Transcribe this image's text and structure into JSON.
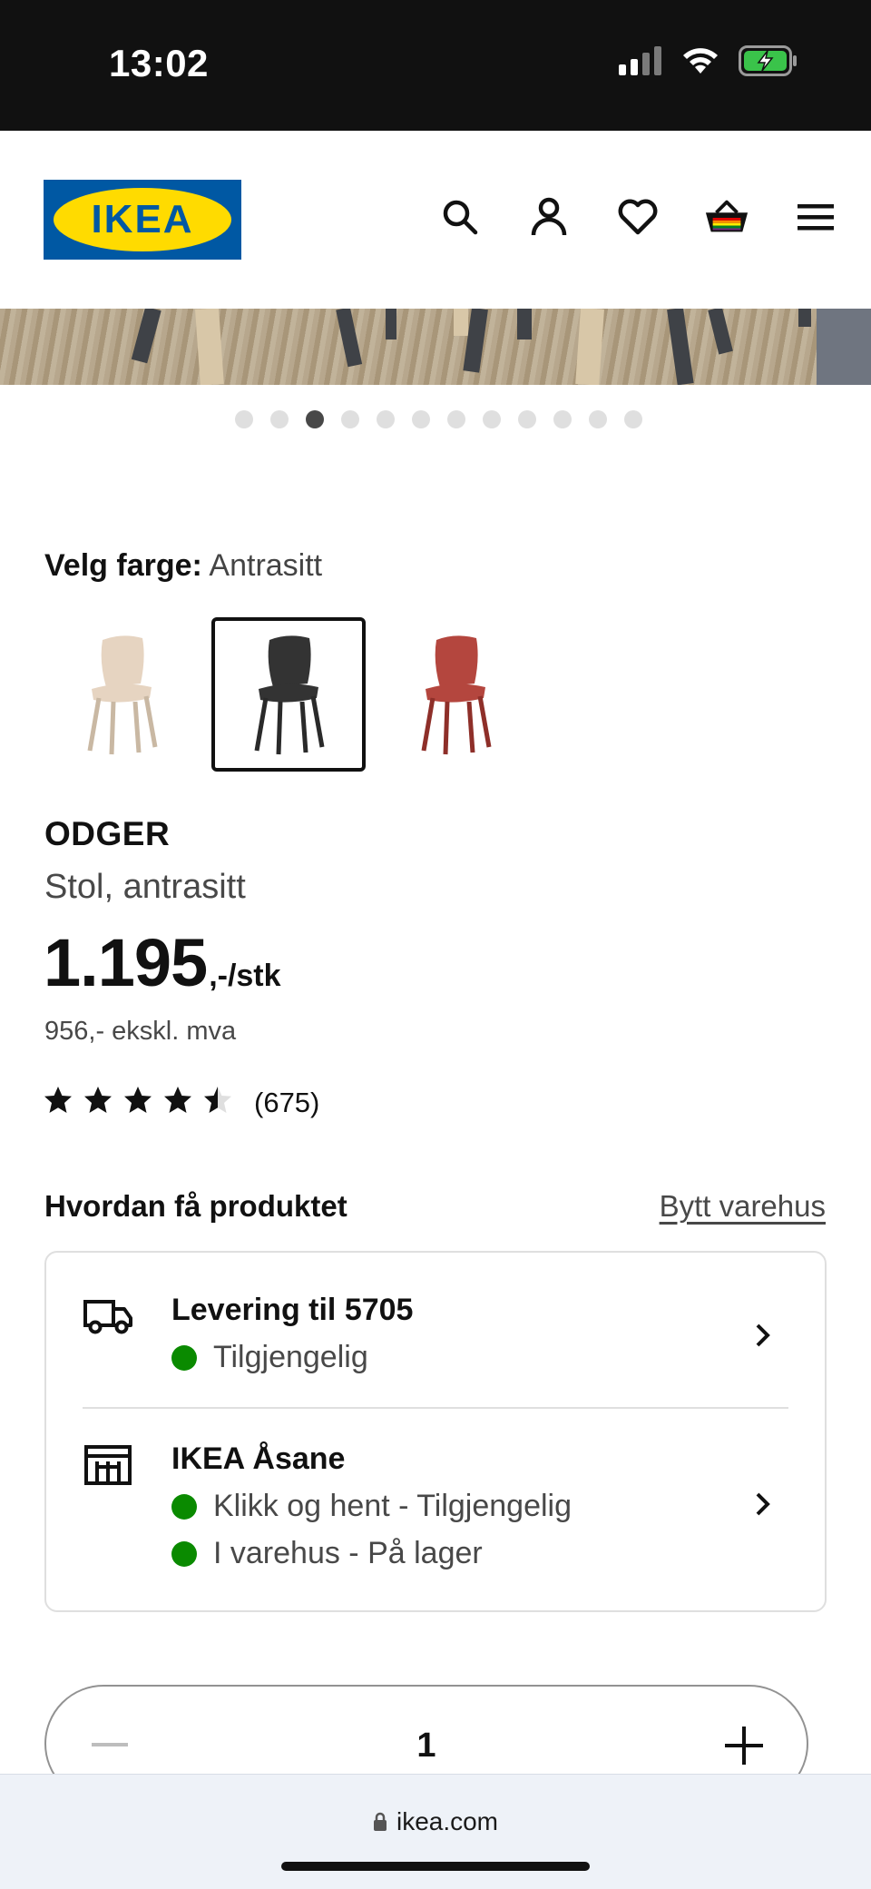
{
  "status_bar": {
    "time": "13:02"
  },
  "header": {
    "logo_text": "IKEA",
    "icons": [
      "search-icon",
      "profile-icon",
      "heart-icon",
      "basket-icon",
      "menu-icon"
    ]
  },
  "gallery": {
    "dot_count": 12,
    "active_index": 2
  },
  "color_picker": {
    "label": "Velg farge:",
    "selected": "Antrasitt",
    "options": [
      {
        "name": "beige-white",
        "color": "#e6d4c1",
        "legs": "#c9b8a3"
      },
      {
        "name": "antrasitt",
        "color": "#333333",
        "legs": "#2a2a2a",
        "selected": true
      },
      {
        "name": "red",
        "color": "#b4463e",
        "legs": "#8e2f29"
      }
    ]
  },
  "product": {
    "name": "ODGER",
    "description": "Stol, antrasitt",
    "price": "1.195",
    "price_suffix": ",-/stk",
    "price_ex_vat": "956,- ekskl. mva",
    "rating": 4.5,
    "rating_count": "(675)"
  },
  "availability": {
    "title": "Hvordan få produktet",
    "change_store": "Bytt varehus",
    "delivery": {
      "title": "Levering til 5705",
      "status": "Tilgjengelig"
    },
    "store": {
      "title": "IKEA Åsane",
      "status_1": "Klikk og hent - Tilgjengelig",
      "status_2": "I varehus - På lager"
    },
    "status_color": "#0a8a00"
  },
  "quantity": {
    "value": "1"
  },
  "browser": {
    "url": "ikea.com"
  },
  "colors": {
    "ikea_blue": "#0058a3",
    "ikea_yellow": "#ffdb00",
    "text": "#111111",
    "muted": "#484848"
  }
}
